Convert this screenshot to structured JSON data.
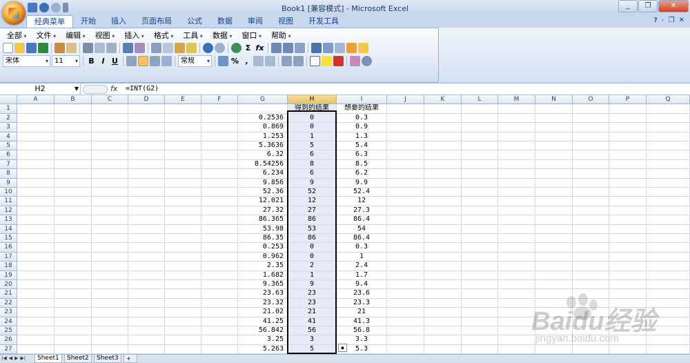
{
  "window": {
    "title": "Book1  [兼容模式] - Microsoft Excel"
  },
  "ribbon_tabs": [
    "经典菜单",
    "开始",
    "插入",
    "页面布局",
    "公式",
    "数据",
    "审阅",
    "视图",
    "开发工具"
  ],
  "menus": [
    "全部",
    "文件",
    "编辑",
    "视图",
    "插入",
    "格式",
    "工具",
    "数据",
    "窗口",
    "帮助"
  ],
  "toolbar": {
    "font_name": "宋体",
    "font_size": "11",
    "number_format": "常规",
    "bold": "B",
    "italic": "I",
    "underline": "U",
    "percent": "%",
    "comma": ","
  },
  "formula_bar": {
    "name_box": "H2",
    "fx": "fx",
    "formula": "=INT(G2)"
  },
  "columns": [
    "A",
    "B",
    "C",
    "D",
    "E",
    "F",
    "G",
    "H",
    "I",
    "J",
    "K",
    "L",
    "M",
    "N",
    "O",
    "P",
    "Q"
  ],
  "header_row": {
    "H": "得到的结果",
    "I": "想要的结果"
  },
  "rows": [
    {
      "n": "2",
      "g": "0.2536",
      "h": "0",
      "i": "0.3"
    },
    {
      "n": "3",
      "g": "0.869",
      "h": "0",
      "i": "0.9"
    },
    {
      "n": "4",
      "g": "1.253",
      "h": "1",
      "i": "1.3"
    },
    {
      "n": "5",
      "g": "5.3636",
      "h": "5",
      "i": "5.4"
    },
    {
      "n": "6",
      "g": "6.32",
      "h": "6",
      "i": "6.3"
    },
    {
      "n": "7",
      "g": "8.54256",
      "h": "8",
      "i": "8.5"
    },
    {
      "n": "8",
      "g": "6.234",
      "h": "6",
      "i": "6.2"
    },
    {
      "n": "9",
      "g": "9.856",
      "h": "9",
      "i": "9.9"
    },
    {
      "n": "10",
      "g": "52.36",
      "h": "52",
      "i": "52.4"
    },
    {
      "n": "11",
      "g": "12.021",
      "h": "12",
      "i": "12"
    },
    {
      "n": "12",
      "g": "27.32",
      "h": "27",
      "i": "27.3"
    },
    {
      "n": "13",
      "g": "86.365",
      "h": "86",
      "i": "86.4"
    },
    {
      "n": "14",
      "g": "53.98",
      "h": "53",
      "i": "54"
    },
    {
      "n": "15",
      "g": "86.35",
      "h": "86",
      "i": "86.4"
    },
    {
      "n": "16",
      "g": "0.253",
      "h": "0",
      "i": "0.3"
    },
    {
      "n": "17",
      "g": "0.962",
      "h": "0",
      "i": "1"
    },
    {
      "n": "18",
      "g": "2.35",
      "h": "2",
      "i": "2.4"
    },
    {
      "n": "19",
      "g": "1.682",
      "h": "1",
      "i": "1.7"
    },
    {
      "n": "20",
      "g": "9.365",
      "h": "9",
      "i": "9.4"
    },
    {
      "n": "21",
      "g": "23.63",
      "h": "23",
      "i": "23.6"
    },
    {
      "n": "22",
      "g": "23.32",
      "h": "23",
      "i": "23.3"
    },
    {
      "n": "23",
      "g": "21.02",
      "h": "21",
      "i": "21"
    },
    {
      "n": "24",
      "g": "41.25",
      "h": "41",
      "i": "41.3"
    },
    {
      "n": "25",
      "g": "56.842",
      "h": "56",
      "i": "56.8"
    },
    {
      "n": "26",
      "g": "3.25",
      "h": "3",
      "i": "3.3"
    },
    {
      "n": "27",
      "g": "5.263",
      "h": "5",
      "i": "5.3"
    }
  ],
  "sheets": [
    "Sheet1",
    "Sheet2",
    "Sheet3"
  ],
  "watermark": {
    "brand": "Baidu经验",
    "url": "jingyan.baidu.com"
  }
}
